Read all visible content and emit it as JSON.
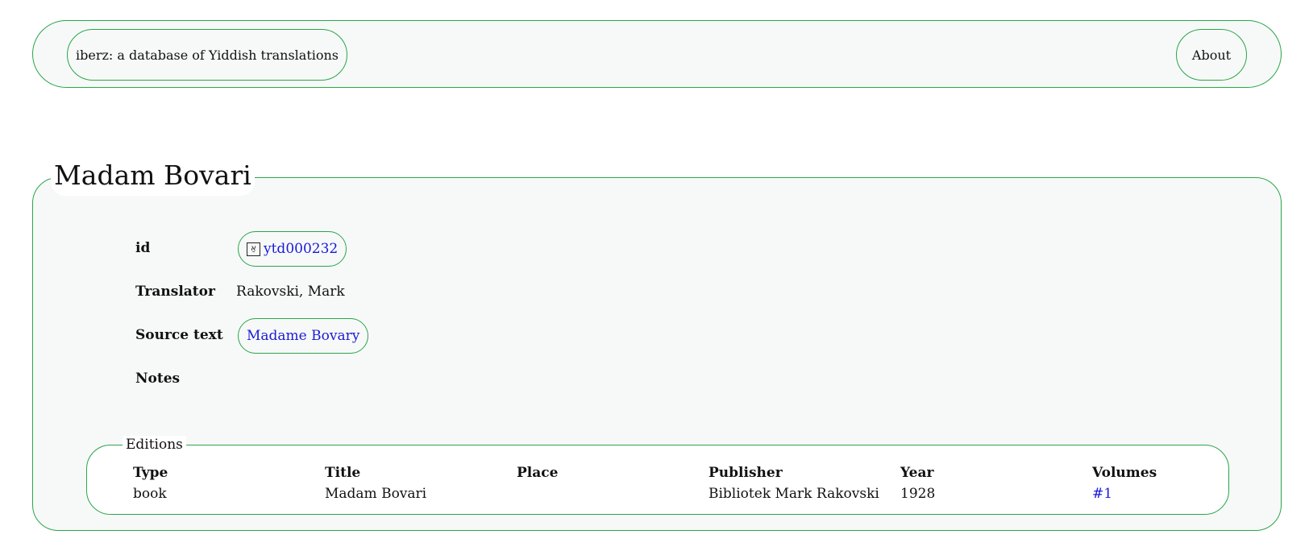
{
  "header": {
    "site_title": "iberz: a database of Yiddish translations",
    "about_label": "About"
  },
  "record": {
    "title": "Madam Bovari",
    "fields": {
      "id_label": "id",
      "id_value": "ytd000232",
      "id_icon_glyph": "אַ",
      "translator_label": "Translator",
      "translator_value": "Rakovski, Mark",
      "source_label": "Source text",
      "source_value": "Madame Bovary",
      "notes_label": "Notes"
    },
    "editions": {
      "legend": "Editions",
      "columns": [
        "Type",
        "Title",
        "Place",
        "Publisher",
        "Year",
        "Volumes"
      ],
      "rows": [
        [
          "book",
          "Madam Bovari",
          "",
          "Bibliotek Mark Rakovski",
          "1928",
          "#1"
        ]
      ]
    }
  },
  "colors": {
    "accent_border": "#2aa54a",
    "panel_bg": "#f7f9f8",
    "link": "#1a1ad8"
  }
}
